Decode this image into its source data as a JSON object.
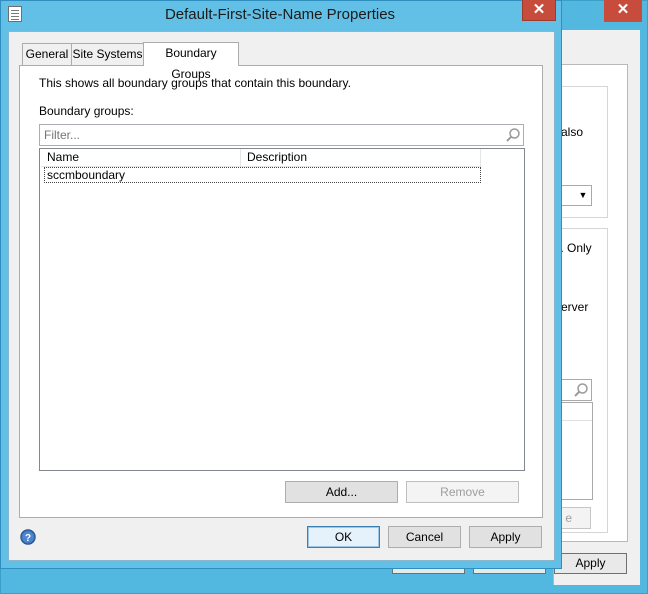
{
  "dialog": {
    "title": "Default-First-Site-Name Properties",
    "close_glyph": "✕",
    "icon": "properties-page-icon"
  },
  "tabs": [
    {
      "label": "General"
    },
    {
      "label": "Site Systems"
    },
    {
      "label": "Boundary Groups",
      "selected": true
    }
  ],
  "boundary_tab": {
    "description": "This shows all boundary groups that contain this boundary.",
    "groups_label": "Boundary groups:",
    "filter_placeholder": "Filter...",
    "columns": [
      "Name",
      "Description"
    ],
    "rows": [
      {
        "name": "sccmboundary",
        "description": ""
      }
    ],
    "add_label": "Add...",
    "remove_label": "Remove"
  },
  "footer": {
    "ok_label": "OK",
    "cancel_label": "Cancel",
    "apply_label": "Apply",
    "help_icon": "help-icon"
  },
  "background_dialog": {
    "text_also": "also",
    "text_only": "t. Only",
    "text_erver": "erver",
    "button_fragment": "e",
    "apply_label": "Apply",
    "close_glyph": "✕"
  },
  "colors": {
    "frame": "#62c0e6",
    "close": "#c74c3c",
    "client": "#f0f0f0"
  }
}
